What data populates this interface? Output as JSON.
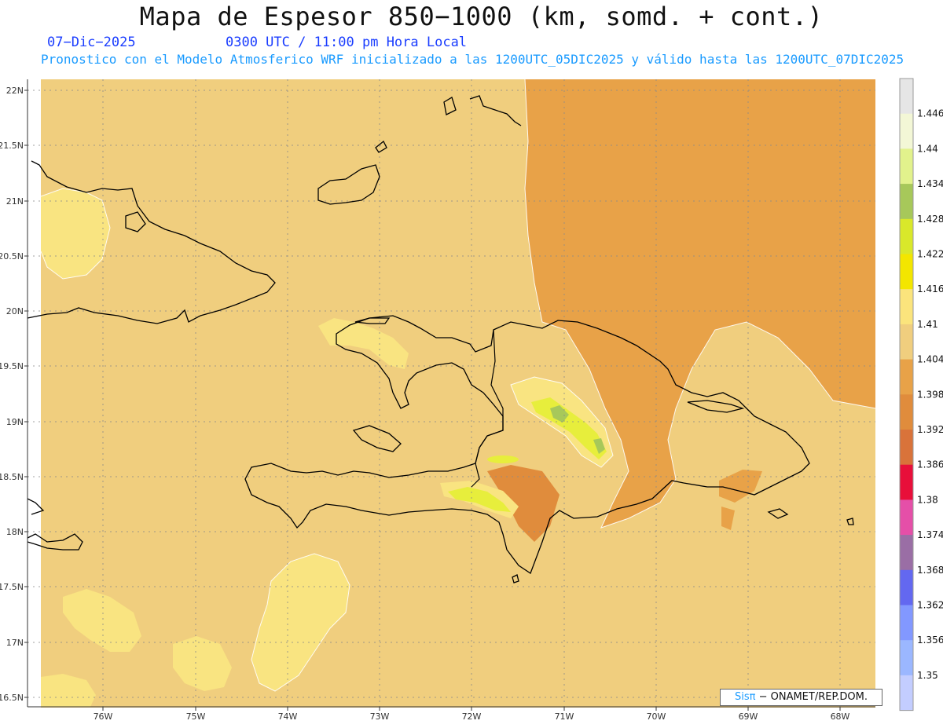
{
  "title": "Mapa de Espesor 850−1000 (km, somd. + cont.)",
  "date_label": "07−Dic−2025",
  "time_label": "0300 UTC / 11:00 pm Hora Local",
  "subtitle": "Pronostico con el Modelo Atmosferico WRF inicializado a las 1200UTC_05DIC2025 y válido hasta las  1200UTC_07DIC2025",
  "credit": {
    "prefix": "Sis",
    "pi": "π",
    "suffix": " − ONAMET/REP.DOM."
  },
  "map": {
    "lat_labels": [
      "22N",
      "21.5N",
      "21N",
      "20.5N",
      "20N",
      "19.5N",
      "19N",
      "18.5N",
      "18N",
      "17.5N",
      "17N",
      "16.5N"
    ],
    "lon_labels": [
      "76W",
      "75W",
      "74W",
      "73W",
      "72W",
      "71W",
      "70W",
      "69W",
      "68W"
    ],
    "colors": {
      "background": "#f0ce7e",
      "high": "#f9e481",
      "low": "#e8a248",
      "lower": "#e08c3c",
      "peak": "#d8e73c",
      "coast": "#000000"
    }
  },
  "colorbar": {
    "labels": [
      "1.446",
      "1.44",
      "1.434",
      "1.428",
      "1.422",
      "1.416",
      "1.41",
      "1.404",
      "1.398",
      "1.392",
      "1.386",
      "1.38",
      "1.374",
      "1.368",
      "1.362",
      "1.356",
      "1.35"
    ],
    "colors": [
      "#e6e6e6",
      "#f3f7d6",
      "#e2f28c",
      "#a7c85a",
      "#d9e82a",
      "#f3e600",
      "#fbe47c",
      "#f0ce7e",
      "#e8a248",
      "#e08c3c",
      "#d9733a",
      "#e80f3a",
      "#e54fa8",
      "#9a6ea5",
      "#6368f0",
      "#8298ff",
      "#9bb7ff",
      "#c3cdff"
    ]
  }
}
